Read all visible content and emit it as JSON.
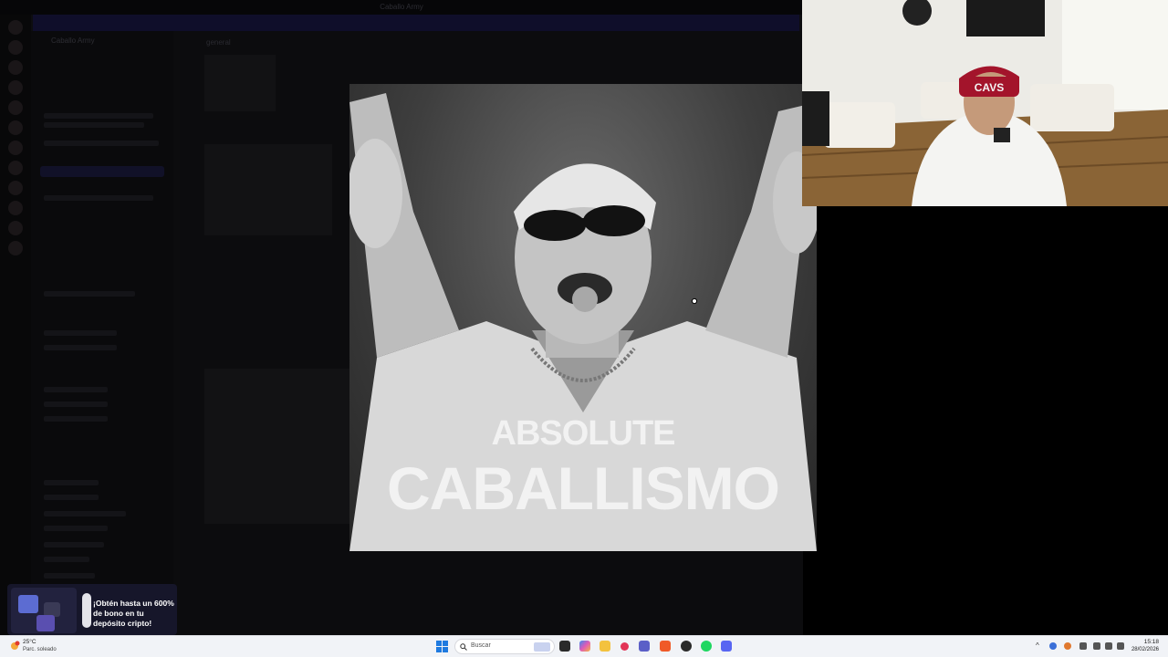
{
  "background_window": {
    "title": "Caballo Army",
    "server_name": "Caballo Army",
    "channel_header": "general"
  },
  "meme": {
    "line1": "ABSOLUTE",
    "line2": "CABALLISMO"
  },
  "ad": {
    "text": "¡Obtén hasta un 600% de bono en tu depósito cripto!"
  },
  "taskbar": {
    "weather_temp": "25°C",
    "weather_desc": "Parc. soleado",
    "search_label": "Buscar",
    "clock_time": "15:18",
    "clock_date": "28/02/2026"
  },
  "colors": {
    "taskbar_bg": "#f1f3f7",
    "meme_text": "#f2f2f2",
    "ad_bg": "#16162a",
    "banner": "#0f0e2a"
  },
  "icons": [
    "windows-start-icon",
    "search-icon",
    "file-explorer-icon",
    "copilot-icon",
    "folder-icon",
    "teams-icon",
    "brave-icon",
    "chrome-icon",
    "spotify-icon",
    "discord-icon",
    "wifi-icon",
    "volume-icon",
    "battery-icon"
  ]
}
